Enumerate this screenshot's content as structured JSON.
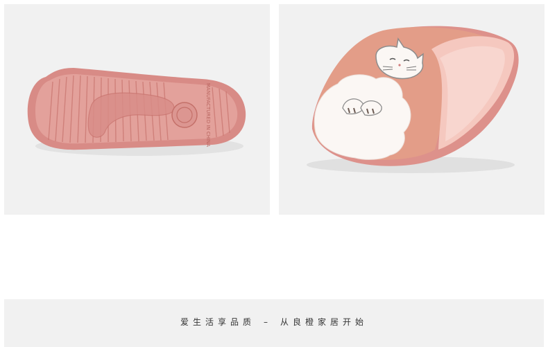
{
  "product_images": [
    {
      "subject": "slipper-sole",
      "tread_text": "MANUFACTURED IN CHINA"
    },
    {
      "subject": "slipper-top",
      "embroidery": "cat-icon"
    }
  ],
  "colors": {
    "panel_background": "#f1f1f1",
    "sole_pink": "#d88b86",
    "upper_pink": "#e39d88",
    "plush_pink": "#f5c8bf",
    "cat_white": "#fbf7f4"
  },
  "footer": {
    "slogan_left": "爱生活享品质",
    "separator": "–",
    "slogan_right": "从良橙家居开始"
  }
}
